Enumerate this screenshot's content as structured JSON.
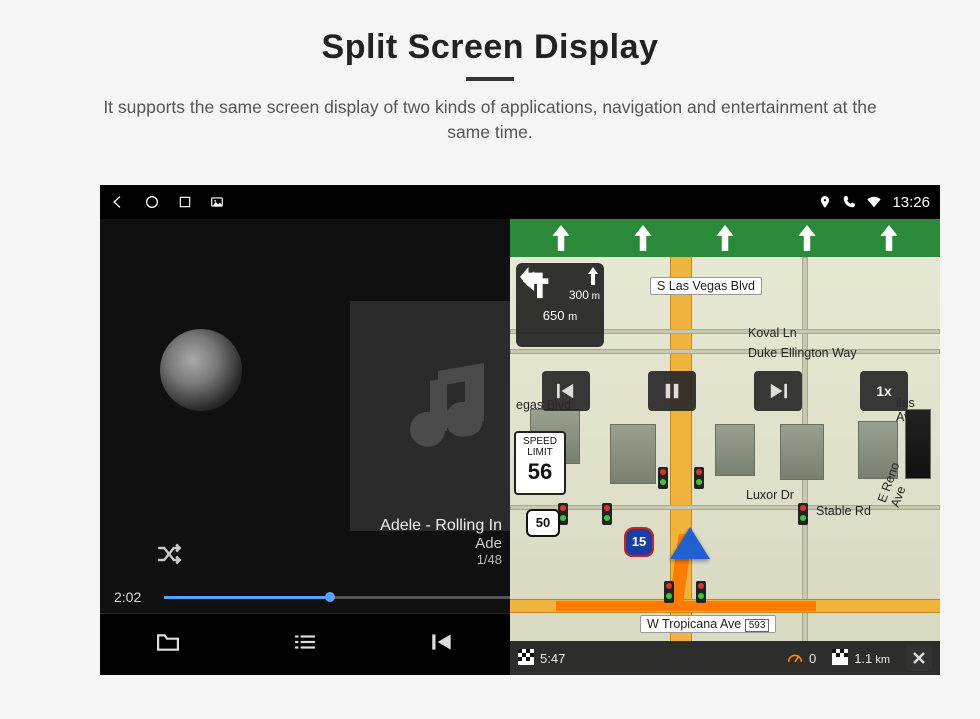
{
  "header": {
    "title": "Split Screen Display",
    "subtitle": "It supports the same screen display of two kinds of applications, navigation and entertainment at the same time."
  },
  "statusbar": {
    "time": "13:26"
  },
  "music": {
    "track_line1": "Adele - Rolling In",
    "track_line2": "Ade",
    "track_index": "1/48",
    "elapsed": "2:02"
  },
  "navigation": {
    "turn": {
      "dist_primary": "300",
      "dist_primary_unit": "m",
      "dist_secondary": "650",
      "dist_secondary_unit": "m"
    },
    "controls": {
      "speed": "1x"
    },
    "speed_limit": {
      "label_top": "SPEED",
      "label_mid": "LIMIT",
      "value": "56"
    },
    "routes": {
      "us": "50",
      "interstate": "15"
    },
    "streets": {
      "top": "S Las Vegas Blvd",
      "koval": "Koval Ln",
      "duke": "Duke Ellington Way",
      "vegas_blvd": "egas Blvd",
      "luxor": "Luxor Dr",
      "stable": "Stable Rd",
      "reno": "E Reno Ave",
      "bottom": "W Tropicana Ave",
      "bottom_num": "593",
      "iles": "iles Ave"
    },
    "footer": {
      "eta": "5:47",
      "speed": "0",
      "dist": "1.1",
      "dist_unit": "km"
    }
  }
}
